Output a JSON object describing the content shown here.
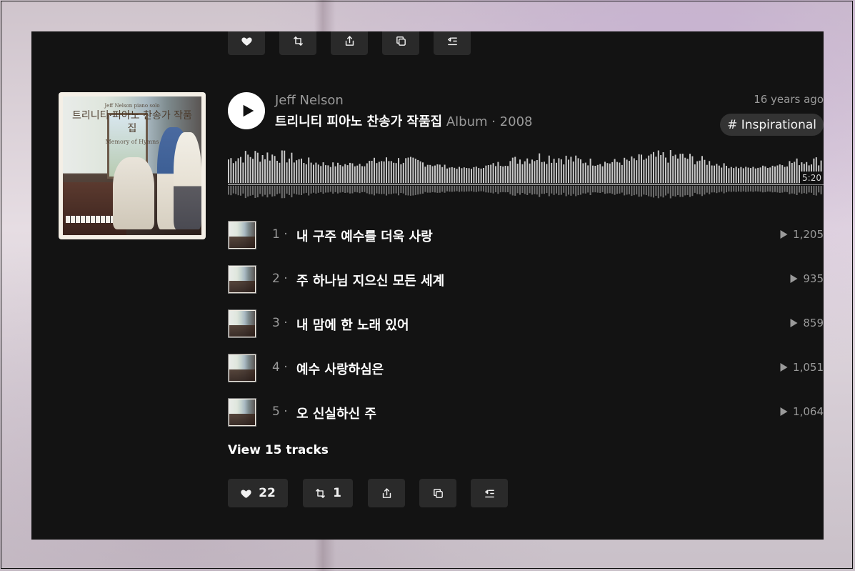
{
  "set": {
    "artist": "Jeff Nelson",
    "album_title": "트리니티 피아노 찬송가 작품집",
    "album_meta": "Album · 2008",
    "posted": "16 years ago",
    "tag": "# Inspirational",
    "duration": "5:20",
    "cover": {
      "small_text": "Jeff Nelson piano solo",
      "title": "트리니티·피아노 찬송가 작품집",
      "subtitle": "Memory of Hymns"
    }
  },
  "tracks": [
    {
      "num": "1",
      "title": "내 구주 예수를 더욱 사랑",
      "plays": "1,205"
    },
    {
      "num": "2",
      "title": "주 하나님 지으신 모든 세계",
      "plays": "935"
    },
    {
      "num": "3",
      "title": "내 맘에 한 노래 있어",
      "plays": "859"
    },
    {
      "num": "4",
      "title": "예수 사랑하심은",
      "plays": "1,051"
    },
    {
      "num": "5",
      "title": "오 신실하신 주",
      "plays": "1,064"
    }
  ],
  "view_all": "View 15 tracks",
  "actions": {
    "like_count": "22",
    "repost_count": "1"
  },
  "icons": [
    "heart-icon",
    "repost-icon",
    "share-icon",
    "copy-icon",
    "add-to-next-up-icon",
    "play-icon"
  ],
  "colors": {
    "panel_bg": "#131313",
    "button_bg": "#2a2a2a",
    "text_muted": "#9a9a9a"
  }
}
